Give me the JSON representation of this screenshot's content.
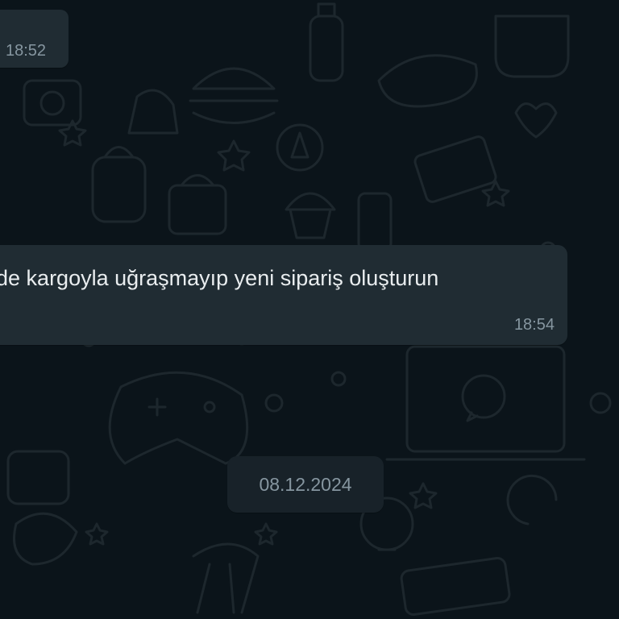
{
  "chat": {
    "messages": [
      {
        "text": "",
        "time": "18:52"
      },
      {
        "text": "ade kargoyla uğraşmayıp yeni sipariş oluşturun",
        "time": "18:54"
      }
    ],
    "date_separator": "08.12.2024"
  },
  "colors": {
    "background": "#0b141a",
    "bubble": "#202c33",
    "date_chip": "#182229",
    "text_primary": "#e9edef",
    "text_secondary": "#8696a0",
    "doodle": "#1c262c"
  }
}
